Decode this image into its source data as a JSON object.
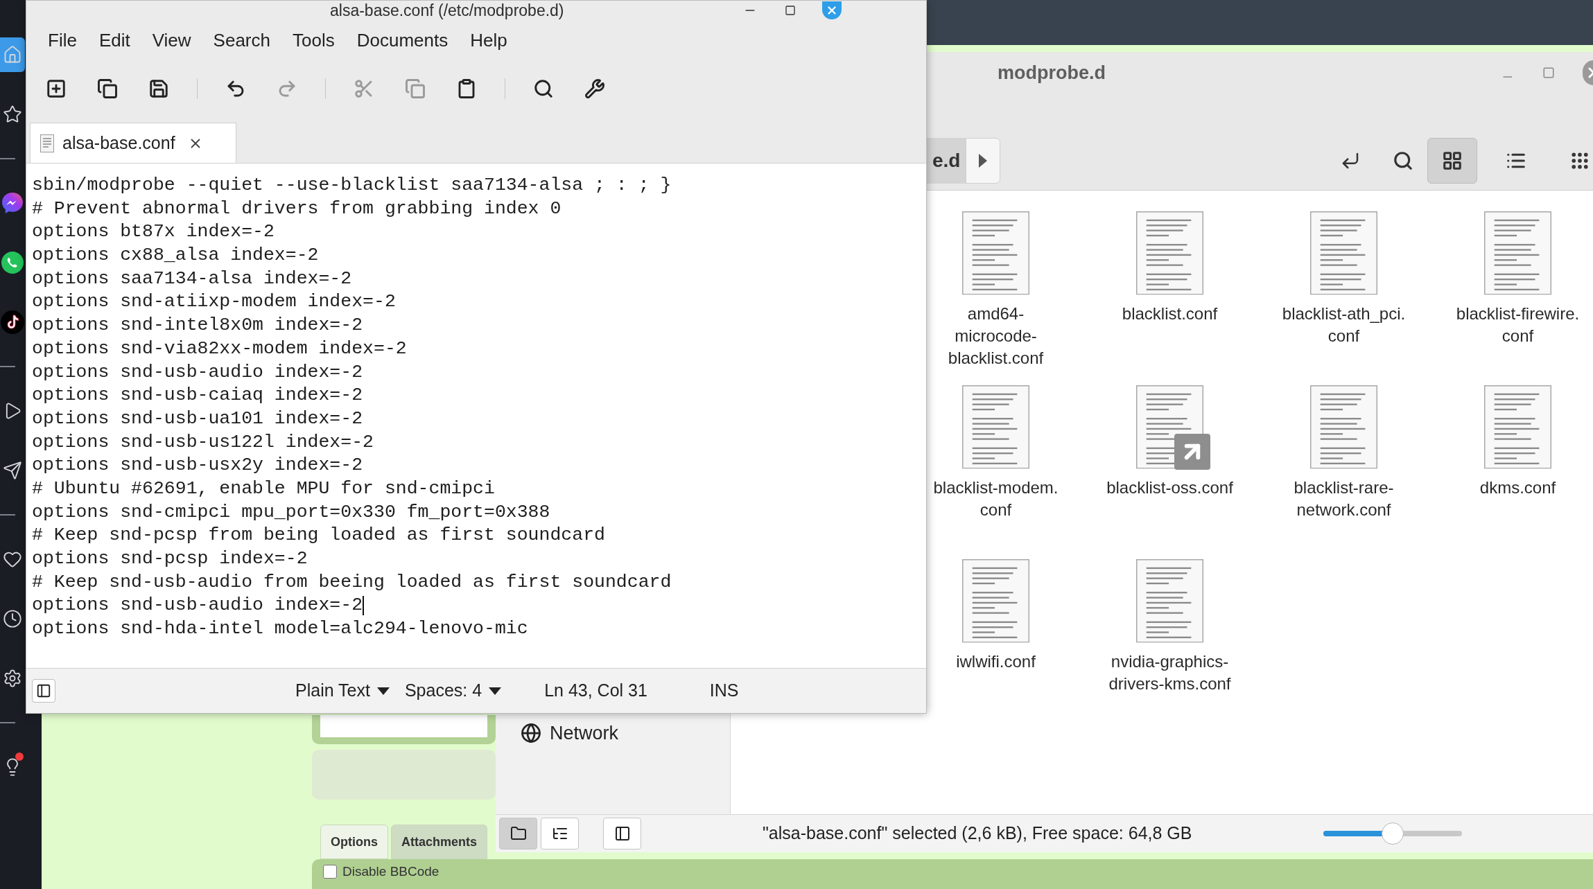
{
  "dock": [
    {
      "kind": "home",
      "selected": true,
      "badge": false
    },
    {
      "kind": "star",
      "selected": false,
      "badge": false
    },
    {
      "kind": "separator"
    },
    {
      "kind": "messenger",
      "selected": false,
      "badge": false
    },
    {
      "kind": "whatsapp",
      "selected": false,
      "badge": false
    },
    {
      "kind": "tiktok",
      "selected": false,
      "badge": false
    },
    {
      "kind": "separator"
    },
    {
      "kind": "play",
      "selected": false,
      "badge": false
    },
    {
      "kind": "send",
      "selected": false,
      "badge": false
    },
    {
      "kind": "separator"
    },
    {
      "kind": "heart",
      "selected": false,
      "badge": false
    },
    {
      "kind": "clock",
      "selected": false,
      "badge": false
    },
    {
      "kind": "settings",
      "selected": false,
      "badge": false
    },
    {
      "kind": "separator"
    },
    {
      "kind": "bulb",
      "selected": false,
      "badge": true
    }
  ],
  "web_page": {
    "tabs": [
      {
        "label": "Options",
        "selected": true
      },
      {
        "label": "Attachments",
        "selected": false
      }
    ],
    "checkbox": {
      "label": "Disable BBCode",
      "checked": false
    }
  },
  "file_manager": {
    "title": "modprobe.d",
    "path_button": "e.d",
    "view_buttons": [
      {
        "kind": "grid",
        "selected": true
      },
      {
        "kind": "list",
        "selected": false
      },
      {
        "kind": "compact",
        "selected": false
      }
    ],
    "sidebar": {
      "items": [
        {
          "label": "Network"
        }
      ]
    },
    "files": [
      {
        "label_lines": [
          "amd64-",
          "microcode-",
          "blacklist.conf"
        ],
        "link": false
      },
      {
        "label_lines": [
          "blacklist.conf"
        ],
        "link": false
      },
      {
        "label_lines": [
          "blacklist-ath_pci.",
          "conf"
        ],
        "link": false
      },
      {
        "label_lines": [
          "blacklist-firewire.",
          "conf"
        ],
        "link": false
      },
      {
        "label_lines": [
          "blacklist-modem.",
          "conf"
        ],
        "link": false
      },
      {
        "label_lines": [
          "blacklist-oss.conf"
        ],
        "link": true
      },
      {
        "label_lines": [
          "blacklist-rare-",
          "network.conf"
        ],
        "link": false
      },
      {
        "label_lines": [
          "dkms.conf"
        ],
        "link": false
      },
      {
        "label_lines": [
          "iwlwifi.conf"
        ],
        "link": false
      },
      {
        "label_lines": [
          "nvidia-graphics-",
          "drivers-kms.conf"
        ],
        "link": false
      }
    ],
    "status_buttons": [
      {
        "kind": "folder",
        "selected": true
      },
      {
        "kind": "tree",
        "selected": false
      },
      {
        "kind": "sidebar",
        "selected": false
      }
    ],
    "status_text": "\"alsa-base.conf\" selected (2,6 kB), Free space: 64,8 GB",
    "zoom_slider": {
      "level": 0.5
    }
  },
  "editor": {
    "title": "alsa-base.conf (/etc/modprobe.d)",
    "menu": [
      "File",
      "Edit",
      "View",
      "Search",
      "Tools",
      "Documents",
      "Help"
    ],
    "toolbar": [
      [
        {
          "kind": "new",
          "disabled": false
        },
        {
          "kind": "open",
          "disabled": false
        },
        {
          "kind": "save",
          "disabled": false
        }
      ],
      [
        {
          "kind": "undo",
          "disabled": false
        },
        {
          "kind": "redo",
          "disabled": true
        }
      ],
      [
        {
          "kind": "cut",
          "disabled": true
        },
        {
          "kind": "copy",
          "disabled": true
        },
        {
          "kind": "paste",
          "disabled": false
        }
      ],
      [
        {
          "kind": "search",
          "disabled": false
        },
        {
          "kind": "tools",
          "disabled": false
        }
      ]
    ],
    "tab": {
      "label": "alsa-base.conf",
      "selected": true
    },
    "lines": [
      {
        "text": "sbin/modprobe --quiet --use-blacklist saa7134-alsa ; : ; }",
        "cursor": false
      },
      {
        "text": "# Prevent abnormal drivers from grabbing index 0",
        "cursor": false
      },
      {
        "text": "options bt87x index=-2",
        "cursor": false
      },
      {
        "text": "options cx88_alsa index=-2",
        "cursor": false
      },
      {
        "text": "options saa7134-alsa index=-2",
        "cursor": false
      },
      {
        "text": "options snd-atiixp-modem index=-2",
        "cursor": false
      },
      {
        "text": "options snd-intel8x0m index=-2",
        "cursor": false
      },
      {
        "text": "options snd-via82xx-modem index=-2",
        "cursor": false
      },
      {
        "text": "options snd-usb-audio index=-2",
        "cursor": false
      },
      {
        "text": "options snd-usb-caiaq index=-2",
        "cursor": false
      },
      {
        "text": "options snd-usb-ua101 index=-2",
        "cursor": false
      },
      {
        "text": "options snd-usb-us122l index=-2",
        "cursor": false
      },
      {
        "text": "options snd-usb-usx2y index=-2",
        "cursor": false
      },
      {
        "text": "# Ubuntu #62691, enable MPU for snd-cmipci",
        "cursor": false
      },
      {
        "text": "options snd-cmipci mpu_port=0x330 fm_port=0x388",
        "cursor": false
      },
      {
        "text": "# Keep snd-pcsp from being loaded as first soundcard",
        "cursor": false
      },
      {
        "text": "options snd-pcsp index=-2",
        "cursor": false
      },
      {
        "text": "# Keep snd-usb-audio from beeing loaded as first soundcard",
        "cursor": false
      },
      {
        "text": "options snd-usb-audio index=-2",
        "cursor": true
      },
      {
        "text": "options snd-hda-intel model=alc294-lenovo-mic",
        "cursor": false
      }
    ],
    "status": {
      "language": "Plain Text",
      "indent": "Spaces: 4",
      "position": "Ln 43, Col 31",
      "mode": "INS"
    }
  }
}
